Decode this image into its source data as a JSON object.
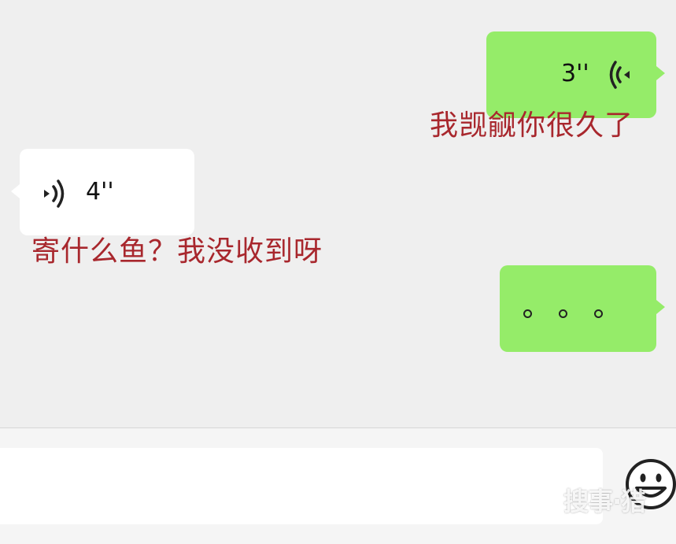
{
  "messages": [
    {
      "side": "right",
      "type": "voice",
      "duration": "3''",
      "caption": "我觊觎你很久了"
    },
    {
      "side": "left",
      "type": "voice",
      "duration": "4''",
      "caption": "寄什么鱼？我没收到呀"
    },
    {
      "side": "right",
      "type": "text",
      "content": "。。。"
    }
  ],
  "input": {
    "value": "",
    "placeholder": ""
  },
  "watermark": "搜事·猎",
  "colors": {
    "sent_bubble": "#95ec69",
    "received_bubble": "#ffffff",
    "caption": "#a8272d",
    "background": "#efefef"
  }
}
